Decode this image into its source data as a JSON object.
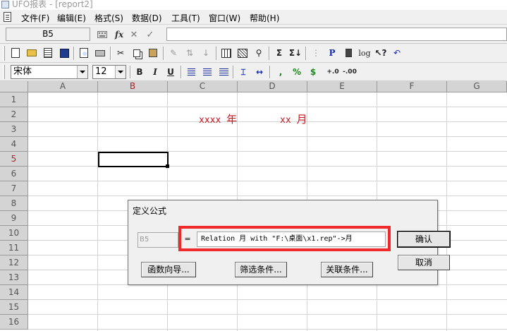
{
  "window": {
    "title": "UFO报表 - [report2]"
  },
  "menu": {
    "items": [
      "文件(F)",
      "编辑(E)",
      "格式(S)",
      "数据(D)",
      "工具(T)",
      "窗口(W)",
      "帮助(H)"
    ]
  },
  "formula_bar": {
    "cell_ref": "B5",
    "fx_label": "fx",
    "cancel_glyph": "✕",
    "confirm_glyph": "✓",
    "formula_value": ""
  },
  "toolbar1": {
    "sum_label": "Σ",
    "p_label": "P",
    "log_label": "log"
  },
  "toolbar2": {
    "font_name": "宋体",
    "font_size": "12",
    "bold_label": "B",
    "italic_label": "I",
    "underline_label": "U",
    "comma_label": ",",
    "percent_label": "%",
    "currency_label": "$"
  },
  "sheet": {
    "columns": [
      "A",
      "B",
      "C",
      "D",
      "E",
      "F",
      "G"
    ],
    "active_column": "B",
    "rows": [
      "1",
      "2",
      "3",
      "4",
      "5",
      "6",
      "7",
      "8",
      "9",
      "10",
      "11",
      "12",
      "13",
      "14",
      "15",
      "16"
    ],
    "active_row": "5",
    "cell_year": {
      "placeholder": "xxxx",
      "unit": "年"
    },
    "cell_month": {
      "placeholder": "xx",
      "unit": "月"
    }
  },
  "dialog": {
    "title": "定义公式",
    "cell_ref": "B5",
    "equals": "=",
    "formula": "Relation 月 with \"F:\\桌面\\x1.rep\"->月",
    "ok_label": "确认",
    "cancel_label": "取消",
    "function_wizard_label": "函数向导...",
    "filter_label": "筛选条件...",
    "relation_label": "关联条件...",
    "highlight_color": "#ee2a2a"
  }
}
